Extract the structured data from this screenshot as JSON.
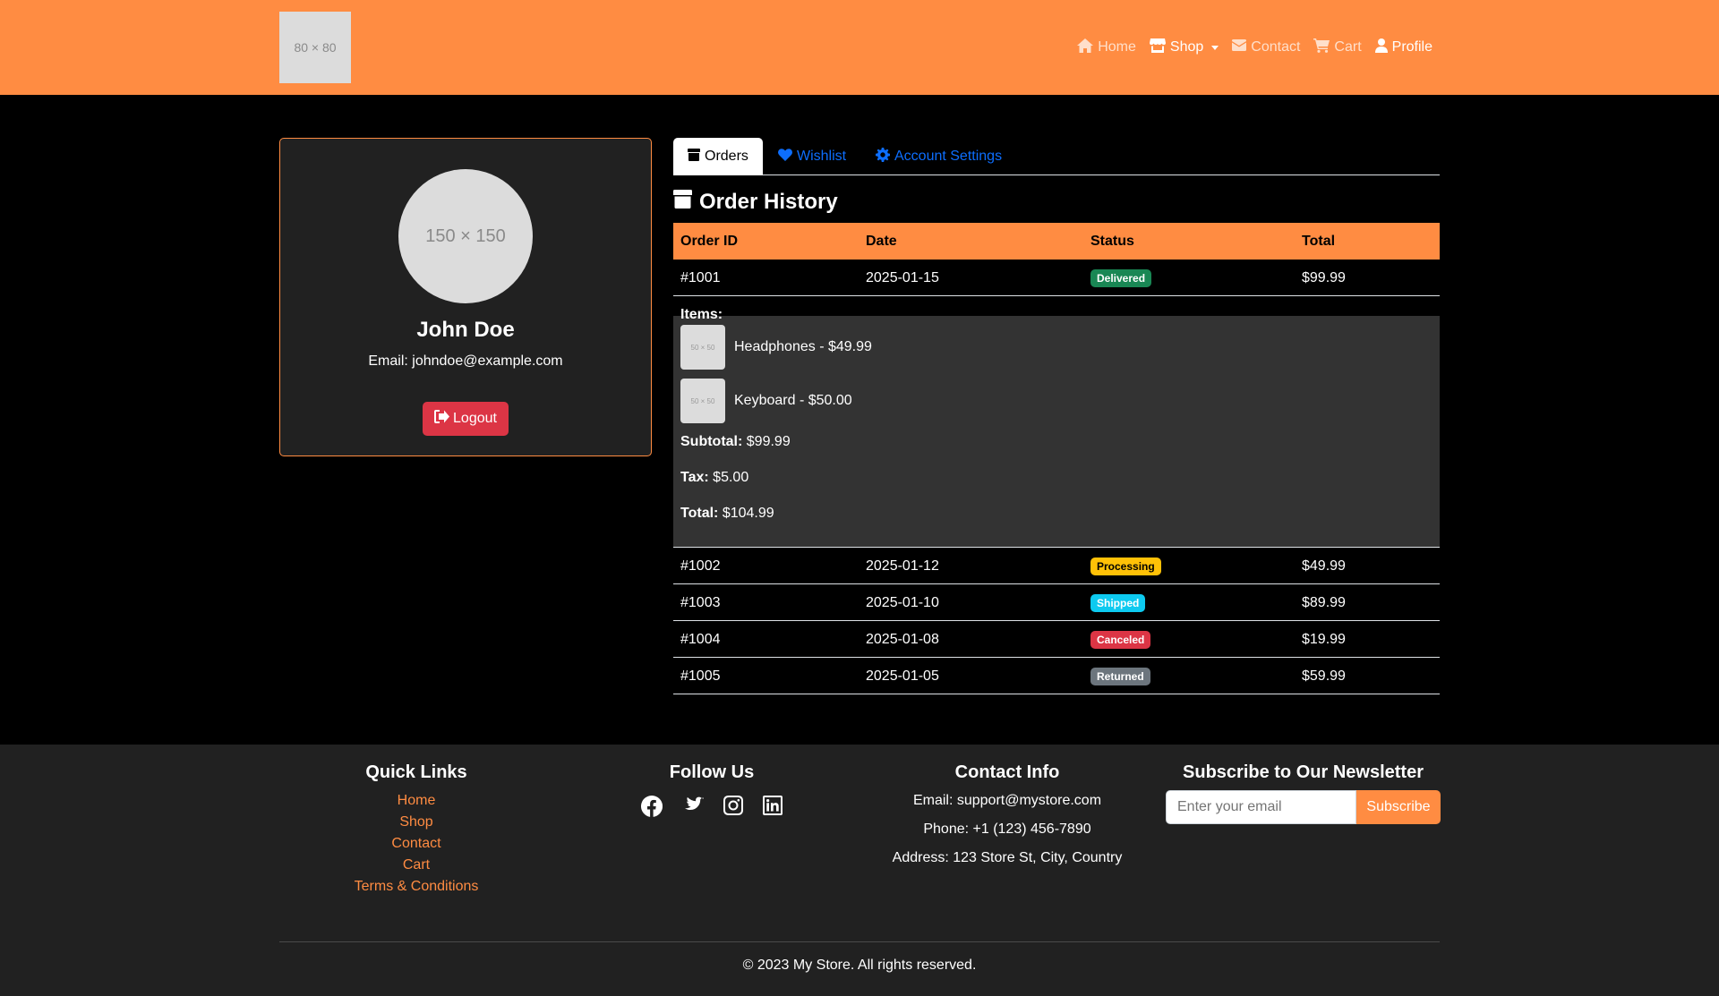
{
  "header": {
    "logo_text": "80 × 80",
    "nav": [
      {
        "label": "Home",
        "icon": "home-icon"
      },
      {
        "label": "Shop",
        "icon": "store-icon"
      },
      {
        "label": "Contact",
        "icon": "envelope-icon"
      },
      {
        "label": "Cart",
        "icon": "cart-icon"
      },
      {
        "label": "Profile",
        "icon": "user-icon"
      }
    ]
  },
  "profile": {
    "avatar_text": "150 × 150",
    "name": "John Doe",
    "email": "Email: johndoe@example.com",
    "logout_label": "Logout"
  },
  "tabs": [
    {
      "label": "Orders",
      "icon": "box-icon"
    },
    {
      "label": "Wishlist",
      "icon": "heart-icon"
    },
    {
      "label": "Account Settings",
      "icon": "gear-icon"
    }
  ],
  "orders": {
    "title": "Order History",
    "columns": [
      "Order ID",
      "Date",
      "Status",
      "Total"
    ],
    "rows": [
      {
        "id": "#1001",
        "date": "2025-01-15",
        "status": "Delivered",
        "status_color": "#198754",
        "total": "$99.99"
      },
      {
        "id": "#1002",
        "date": "2025-01-12",
        "status": "Processing",
        "status_color": "#ffc107",
        "total": "$49.99"
      },
      {
        "id": "#1003",
        "date": "2025-01-10",
        "status": "Shipped",
        "status_color": "#0dcaf0",
        "total": "$89.99"
      },
      {
        "id": "#1004",
        "date": "2025-01-08",
        "status": "Canceled",
        "status_color": "#dc3545",
        "total": "$19.99"
      },
      {
        "id": "#1005",
        "date": "2025-01-05",
        "status": "Returned",
        "status_color": "#6c757d",
        "total": "$59.99"
      }
    ],
    "detail": {
      "items_label": "Items:",
      "items": [
        {
          "thumb": "50 × 50",
          "text": "Headphones - $49.99"
        },
        {
          "thumb": "50 × 50",
          "text": "Keyboard - $50.00"
        }
      ],
      "subtotal_label": "Subtotal:",
      "subtotal": "$99.99",
      "tax_label": "Tax:",
      "tax": "$5.00",
      "total_label": "Total:",
      "total": "$104.99"
    }
  },
  "footer": {
    "quick_links": {
      "title": "Quick Links",
      "links": [
        "Home",
        "Shop",
        "Contact",
        "Cart",
        "Terms & Conditions"
      ]
    },
    "follow": {
      "title": "Follow Us",
      "icons": [
        "facebook-icon",
        "twitter-icon",
        "instagram-icon",
        "linkedin-icon"
      ]
    },
    "contact": {
      "title": "Contact Info",
      "email": "Email: support@mystore.com",
      "phone": "Phone: +1 (123) 456-7890",
      "address": "Address: 123 Store St, City, Country"
    },
    "newsletter": {
      "title": "Subscribe to Our Newsletter",
      "placeholder": "Enter your email",
      "button": "Subscribe"
    },
    "copyright": "© 2023 My Store. All rights reserved."
  },
  "colors": {
    "accent": "#ff8c42",
    "card_bg": "#212121",
    "detail_bg": "#333333",
    "link_blue": "#0d6efd",
    "danger": "#dc3545"
  }
}
